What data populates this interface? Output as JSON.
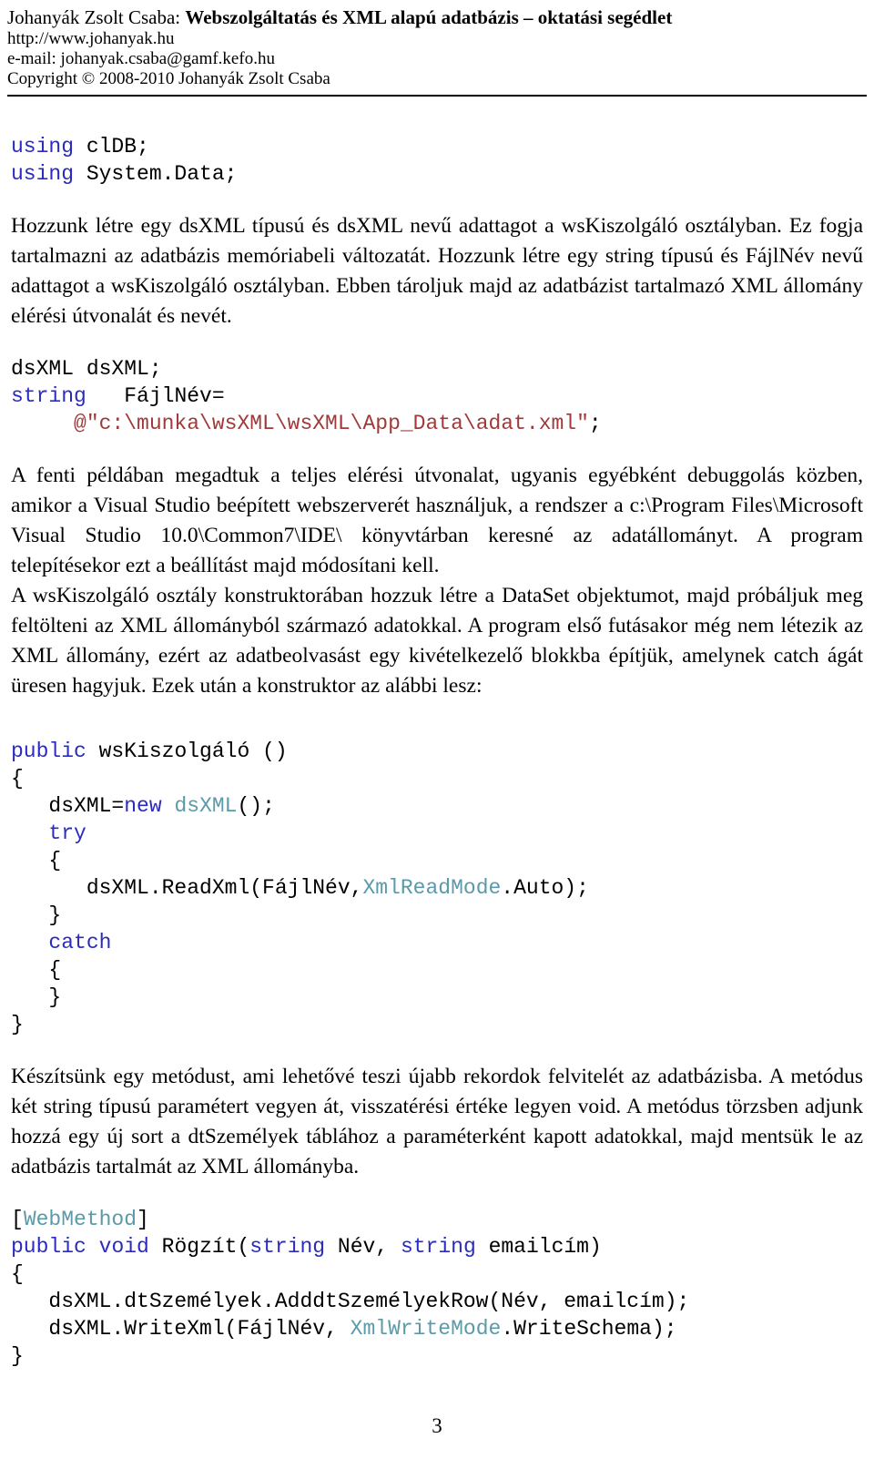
{
  "header": {
    "title_prefix": "Johanyák Zsolt Csaba: ",
    "title_main": "Webszolgáltatás és XML alapú adatbázis – oktatási segédlet",
    "url": "http://www.johanyak.hu",
    "email": "e-mail: johanyak.csaba@gamf.kefo.hu",
    "copyright": "Copyright © 2008-2010 Johanyák Zsolt Csaba"
  },
  "code_block_1": {
    "line1_kw": "using",
    "line1_rest": " clDB;",
    "line2_kw": "using",
    "line2_rest": " System.Data;"
  },
  "paragraph_1": "Hozzunk létre egy dsXML típusú és dsXML nevű adattagot a wsKiszolgáló osztályban. Ez fogja tartalmazni az adatbázis memóriabeli változatát. Hozzunk létre egy string típusú és FájlNév nevű adattagot a wsKiszolgáló osztályban. Ebben tároljuk majd az adatbázist tartalmazó XML állomány elérési útvonalát és nevét.",
  "code_block_2": {
    "line1": "dsXML dsXML;",
    "line2_kw": "string",
    "line2_rest": "   FájlNév=",
    "line3_indent": "     ",
    "line3_str": "@\"c:\\munka\\wsXML\\wsXML\\App_Data\\adat.xml\"",
    "line3_tail": ";"
  },
  "paragraph_2": "A fenti példában megadtuk a teljes elérési útvonalat, ugyanis egyébként debuggolás közben, amikor a Visual Studio beépített webszerverét használjuk, a rendszer a c:\\Program Files\\Microsoft Visual Studio 10.0\\Common7\\IDE\\ könyvtárban keresné az adatállományt. A program telepítésekor ezt a beállítást majd módosítani kell.",
  "paragraph_3": "A wsKiszolgáló osztály konstruktorában hozzuk létre a DataSet objektumot, majd próbáljuk meg feltölteni az XML állományból származó adatokkal. A program első futásakor még nem létezik az XML állomány, ezért az adatbeolvasást egy kivételkezelő blokkba építjük, amelynek catch ágát üresen hagyjuk. Ezek után a konstruktor az alábbi lesz:",
  "code_block_3": {
    "l1_kw": "public",
    "l1_rest": " wsKiszolgáló ()",
    "l2": "{",
    "l3_pre": "   dsXML=",
    "l3_kw": "new",
    "l3_mid": " ",
    "l3_type": "dsXML",
    "l3_tail": "();",
    "l4_indent": "   ",
    "l4_kw": "try",
    "l5": "   {",
    "l6_pre": "      dsXML.ReadXml(FájlNév,",
    "l6_type": "XmlReadMode",
    "l6_tail": ".Auto);",
    "l7": "   }",
    "l8_indent": "   ",
    "l8_kw": "catch",
    "l9": "   {",
    "l10": "   }",
    "l11": "}"
  },
  "paragraph_4": "Készítsünk egy metódust, ami lehetővé teszi újabb rekordok felvitelét az adatbázisba. A metódus két string típusú paramétert vegyen át, visszatérési értéke legyen void. A metódus törzsben adjunk hozzá egy új sort a dtSzemélyek táblához a paraméterként kapott adatokkal, majd mentsük le az adatbázis tartalmát az XML állományba.",
  "code_block_4": {
    "l1_open": "[",
    "l1_type": "WebMethod",
    "l1_close": "]",
    "l2_kw1": "public",
    "l2_sp1": " ",
    "l2_kw2": "void",
    "l2_mid": " Rögzít(",
    "l2_kw3": "string",
    "l2_mid2": " Név, ",
    "l2_kw4": "string",
    "l2_tail": " emailcím)",
    "l3": "{",
    "l4": "   dsXML.dtSzemélyek.AdddtSzemélyekRow(Név, emailcím);",
    "l5_pre": "   dsXML.WriteXml(FájlNév, ",
    "l5_type": "XmlWriteMode",
    "l5_tail": ".WriteSchema);",
    "l6": "}"
  },
  "footer": {
    "page_number": "3"
  },
  "colors": {
    "keyword": "#2b2bbf",
    "type": "#5b9aa8",
    "string": "#a03a3a",
    "text": "#000000",
    "background": "#ffffff"
  }
}
